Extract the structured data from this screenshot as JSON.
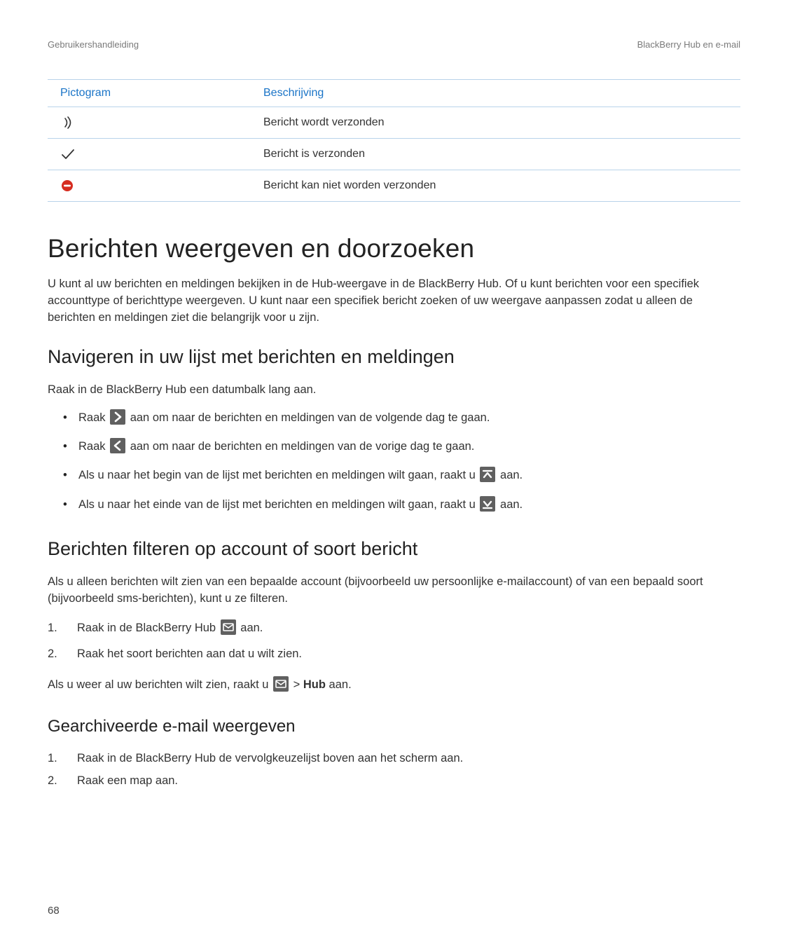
{
  "header": {
    "left": "Gebruikershandleiding",
    "right": "BlackBerry Hub en e-mail"
  },
  "table": {
    "col_icon": "Pictogram",
    "col_desc": "Beschrijving",
    "rows": [
      {
        "icon": "sending-icon",
        "desc": "Bericht wordt verzonden"
      },
      {
        "icon": "sent-icon",
        "desc": "Bericht is verzonden"
      },
      {
        "icon": "error-icon",
        "desc": "Bericht kan niet worden verzonden"
      }
    ]
  },
  "h1": "Berichten weergeven en doorzoeken",
  "intro": "U kunt al uw berichten en meldingen bekijken in de Hub-weergave in de BlackBerry Hub. Of u kunt berichten voor een specifiek accounttype of berichttype weergeven. U kunt naar een specifiek bericht zoeken of uw weergave aanpassen zodat u alleen de berichten en meldingen ziet die belangrijk voor u zijn.",
  "nav": {
    "h2": "Navigeren in uw lijst met berichten en meldingen",
    "lead": "Raak in de BlackBerry Hub een datumbalk lang aan.",
    "b1_a": "Raak ",
    "b1_b": " aan om naar de berichten en meldingen van de volgende dag te gaan.",
    "b2_a": "Raak ",
    "b2_b": " aan om naar de berichten en meldingen van de vorige dag te gaan.",
    "b3_a": "Als u naar het begin van de lijst met berichten en meldingen wilt gaan, raakt u ",
    "b3_b": " aan.",
    "b4_a": "Als u naar het einde van de lijst met berichten en meldingen wilt gaan, raakt u ",
    "b4_b": " aan."
  },
  "filter": {
    "h2": "Berichten filteren op account of soort bericht",
    "lead": "Als u alleen berichten wilt zien van een bepaalde account (bijvoorbeeld uw persoonlijke e-mailaccount) of van een bepaald soort (bijvoorbeeld sms-berichten), kunt u ze filteren.",
    "s1_num": "1.",
    "s1_a": "Raak in de BlackBerry Hub ",
    "s1_b": " aan.",
    "s2_num": "2.",
    "s2": "Raak het soort berichten aan dat u wilt zien.",
    "tail_a": "Als u weer al uw berichten wilt zien, raakt u ",
    "tail_b": "  > ",
    "tail_hub": "Hub",
    "tail_c": " aan."
  },
  "archive": {
    "h3": "Gearchiveerde e-mail weergeven",
    "s1_num": "1.",
    "s1": "Raak in de BlackBerry Hub de vervolgkeuzelijst boven aan het scherm aan.",
    "s2_num": "2.",
    "s2": "Raak een map aan."
  },
  "page": "68"
}
